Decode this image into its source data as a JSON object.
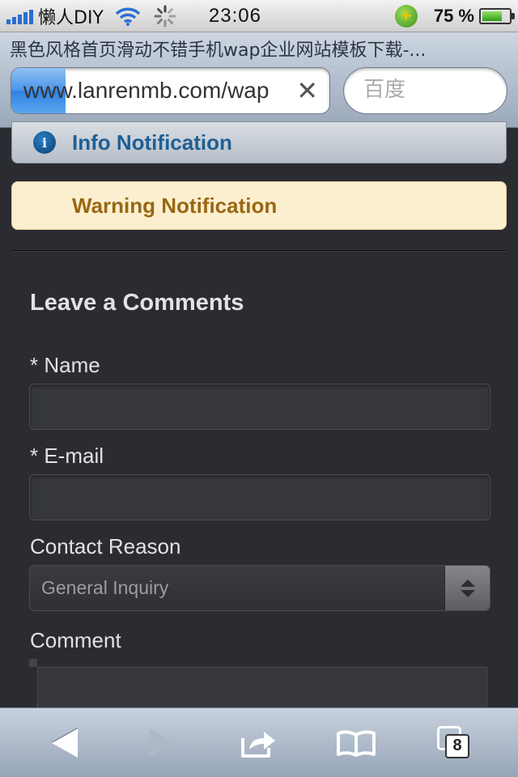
{
  "status_bar": {
    "carrier": "懒人DIY",
    "time": "23:06",
    "battery_percent": "75 %",
    "battery_level": 0.75
  },
  "browser": {
    "page_title": "黑色风格首页滑动不错手机wap企业网站模板下载-...",
    "url": "www.lanrenmb.com/wap",
    "search_placeholder": "百度",
    "load_progress": 0.17
  },
  "notifications": {
    "info": "Info Notification",
    "warning": "Warning Notification"
  },
  "form": {
    "heading": "Leave a Comments",
    "name_label": "* Name",
    "email_label": "* E-mail",
    "reason_label": "Contact Reason",
    "reason_selected": "General Inquiry",
    "comment_label": "Comment"
  },
  "toolbar": {
    "tab_count": "8"
  },
  "icons": {
    "info": "info-icon",
    "clear": "clear-icon",
    "back": "back-arrow-icon",
    "forward": "forward-arrow-icon",
    "share": "share-icon",
    "bookmarks": "bookmarks-icon",
    "pages": "pages-icon"
  },
  "colors": {
    "page_background": "#2b2c31",
    "info_text": "#1e5f95",
    "warning_background": "#fcefd0",
    "warning_text": "#9a6712"
  }
}
